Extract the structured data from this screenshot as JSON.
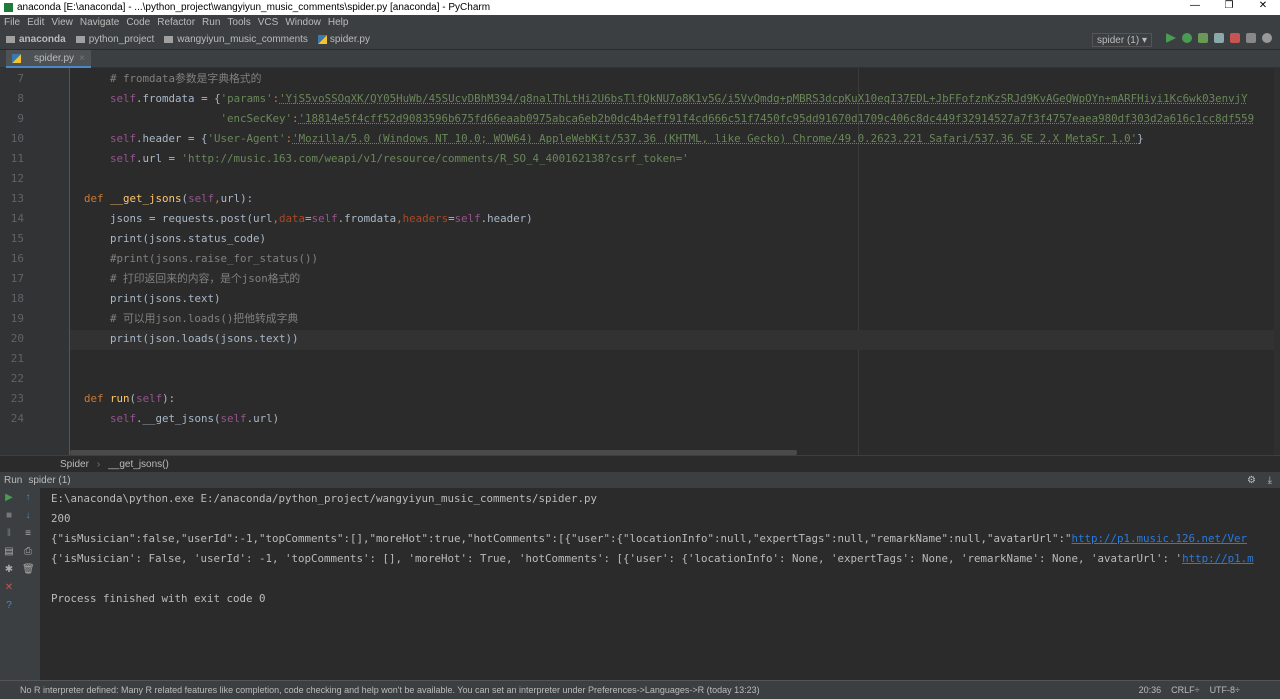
{
  "window": {
    "title": "anaconda [E:\\anaconda] - ...\\python_project\\wangyiyun_music_comments\\spider.py [anaconda] - PyCharm",
    "controls": [
      "—",
      "❐",
      "✕"
    ]
  },
  "menu": [
    "File",
    "Edit",
    "View",
    "Navigate",
    "Code",
    "Refactor",
    "Run",
    "Tools",
    "VCS",
    "Window",
    "Help"
  ],
  "nav": {
    "crumbs": [
      "anaconda",
      "python_project",
      "wangyiyun_music_comments",
      "spider.py"
    ],
    "run_config": "spider (1) ▾"
  },
  "tab": {
    "label": "spider.py",
    "close": "×"
  },
  "editor": {
    "lines": [
      {
        "n": "7",
        "tokens": [
          {
            "t": "        # ",
            "c": "cm"
          },
          {
            "t": "fromdata参数是字典格式的",
            "c": "cm"
          }
        ]
      },
      {
        "n": "8",
        "tokens": [
          {
            "t": "        "
          },
          {
            "t": "self",
            "c": "self"
          },
          {
            "t": "."
          },
          {
            "t": "fromdata",
            "c": ""
          },
          {
            "t": " = {"
          },
          {
            "t": "'params'",
            "c": "str"
          },
          {
            "t": ":",
            "c": "kw"
          },
          {
            "t": "'YjS5voSSOqXK/QY05HuWb/45SUcvDBhM394/q8nalThLtHi2U6bsTlfQkNU7o8K1v5G/i5VvQmdg+pMBRS3dcpKuX10eqI37EDL+JbFFofznKzSRJd9KvAGeQWpOYn+mARFHiyi1Kc6wk03envjY",
            "c": "str ul"
          }
        ]
      },
      {
        "n": "9",
        "tokens": [
          {
            "t": "                         "
          },
          {
            "t": "'encSecKey'",
            "c": "str"
          },
          {
            "t": ":",
            "c": "kw"
          },
          {
            "t": "'18814e5f4cff52d9083596b675fd66eaab0975abca6eb2b0dc4b4eff91f4cd666c51f7450fc95dd91670d1709c406c8dc449f32914527a7f3f4757eaea980df303d2a616c1cc8df559",
            "c": "str ul"
          }
        ]
      },
      {
        "n": "10",
        "tokens": [
          {
            "t": "        "
          },
          {
            "t": "self",
            "c": "self"
          },
          {
            "t": ".header = {"
          },
          {
            "t": "'User-Agent'",
            "c": "str"
          },
          {
            "t": ":",
            "c": "kw"
          },
          {
            "t": "'Mozilla/5.0 (Windows NT 10.0; WOW64) AppleWebKit/537.36 (KHTML, like Gecko) Chrome/49.0.2623.221 Safari/537.36 SE 2.X MetaSr 1.0'",
            "c": "str ul"
          },
          {
            "t": "}"
          }
        ]
      },
      {
        "n": "11",
        "tokens": [
          {
            "t": "        "
          },
          {
            "t": "self",
            "c": "self"
          },
          {
            "t": ".url = "
          },
          {
            "t": "'http://music.163.com/weapi/v1/resource/comments/R_SO_4_400162138?csrf_token='",
            "c": "str"
          }
        ]
      },
      {
        "n": "12",
        "tokens": []
      },
      {
        "n": "13",
        "tokens": [
          {
            "t": "    "
          },
          {
            "t": "def ",
            "c": "kw"
          },
          {
            "t": "__get_jsons",
            "c": "fn"
          },
          {
            "t": "("
          },
          {
            "t": "self",
            "c": "self"
          },
          {
            "t": ",",
            "c": "kw"
          },
          {
            "t": "url):"
          }
        ]
      },
      {
        "n": "14",
        "tokens": [
          {
            "t": "        jsons = requests.post(url"
          },
          {
            "t": ",",
            "c": "kw"
          },
          {
            "t": "data",
            "c": "pr"
          },
          {
            "t": "="
          },
          {
            "t": "self",
            "c": "self"
          },
          {
            "t": ".fromdata"
          },
          {
            "t": ",",
            "c": "kw"
          },
          {
            "t": "headers",
            "c": "pr"
          },
          {
            "t": "="
          },
          {
            "t": "self",
            "c": "self"
          },
          {
            "t": ".header)"
          }
        ]
      },
      {
        "n": "15",
        "tokens": [
          {
            "t": "        print(jsons.status_code)"
          }
        ]
      },
      {
        "n": "16",
        "tokens": [
          {
            "t": "        #print(jsons.raise_for_status())",
            "c": "cm"
          }
        ]
      },
      {
        "n": "17",
        "tokens": [
          {
            "t": "        # 打印返回来的内容，是个json格式的",
            "c": "cm"
          }
        ]
      },
      {
        "n": "18",
        "tokens": [
          {
            "t": "        print(jsons.text)"
          }
        ]
      },
      {
        "n": "19",
        "tokens": [
          {
            "t": "        # 可以用json.loads()把他转成字典",
            "c": "cm"
          }
        ]
      },
      {
        "n": "20",
        "tokens": [
          {
            "t": "        print(json.loads(jsons.text))"
          }
        ]
      },
      {
        "n": "21",
        "tokens": []
      },
      {
        "n": "22",
        "tokens": []
      },
      {
        "n": "23",
        "tokens": [
          {
            "t": "    "
          },
          {
            "t": "def ",
            "c": "kw"
          },
          {
            "t": "run",
            "c": "fn"
          },
          {
            "t": "("
          },
          {
            "t": "self",
            "c": "self"
          },
          {
            "t": "):"
          }
        ]
      },
      {
        "n": "24",
        "tokens": [
          {
            "t": "        "
          },
          {
            "t": "self",
            "c": "self"
          },
          {
            "t": ".__get_jsons("
          },
          {
            "t": "self",
            "c": "self"
          },
          {
            "t": ".url)"
          }
        ]
      }
    ]
  },
  "breadcrumb": [
    "Spider",
    "__get_jsons()"
  ],
  "run": {
    "label": "Run",
    "config": "spider (1)",
    "output": [
      {
        "text": "E:\\anaconda\\python.exe E:/anaconda/python_project/wangyiyun_music_comments/spider.py"
      },
      {
        "text": "200"
      },
      {
        "text": "{\"isMusician\":false,\"userId\":-1,\"topComments\":[],\"moreHot\":true,\"hotComments\":[{\"user\":{\"locationInfo\":null,\"expertTags\":null,\"remarkName\":null,\"avatarUrl\":\"",
        "link": "http://p1.music.126.net/Ver"
      },
      {
        "text": "{'isMusician': False, 'userId': -1, 'topComments': [], 'moreHot': True, 'hotComments': [{'user': {'locationInfo': None, 'expertTags': None, 'remarkName': None, 'avatarUrl': '",
        "link": "http://p1.m"
      },
      {
        "text": ""
      },
      {
        "text": "Process finished with exit code 0"
      }
    ]
  },
  "status": {
    "message": "No R interpreter defined: Many R related features like completion, code checking and help won't be available. You can set an interpreter under Preferences->Languages->R (today 13:23)",
    "position": "20:36",
    "line_sep": "CRLF÷",
    "encoding": "UTF-8÷"
  },
  "colors": {
    "run_green": "#499c54",
    "accent": "#4a88c7"
  }
}
